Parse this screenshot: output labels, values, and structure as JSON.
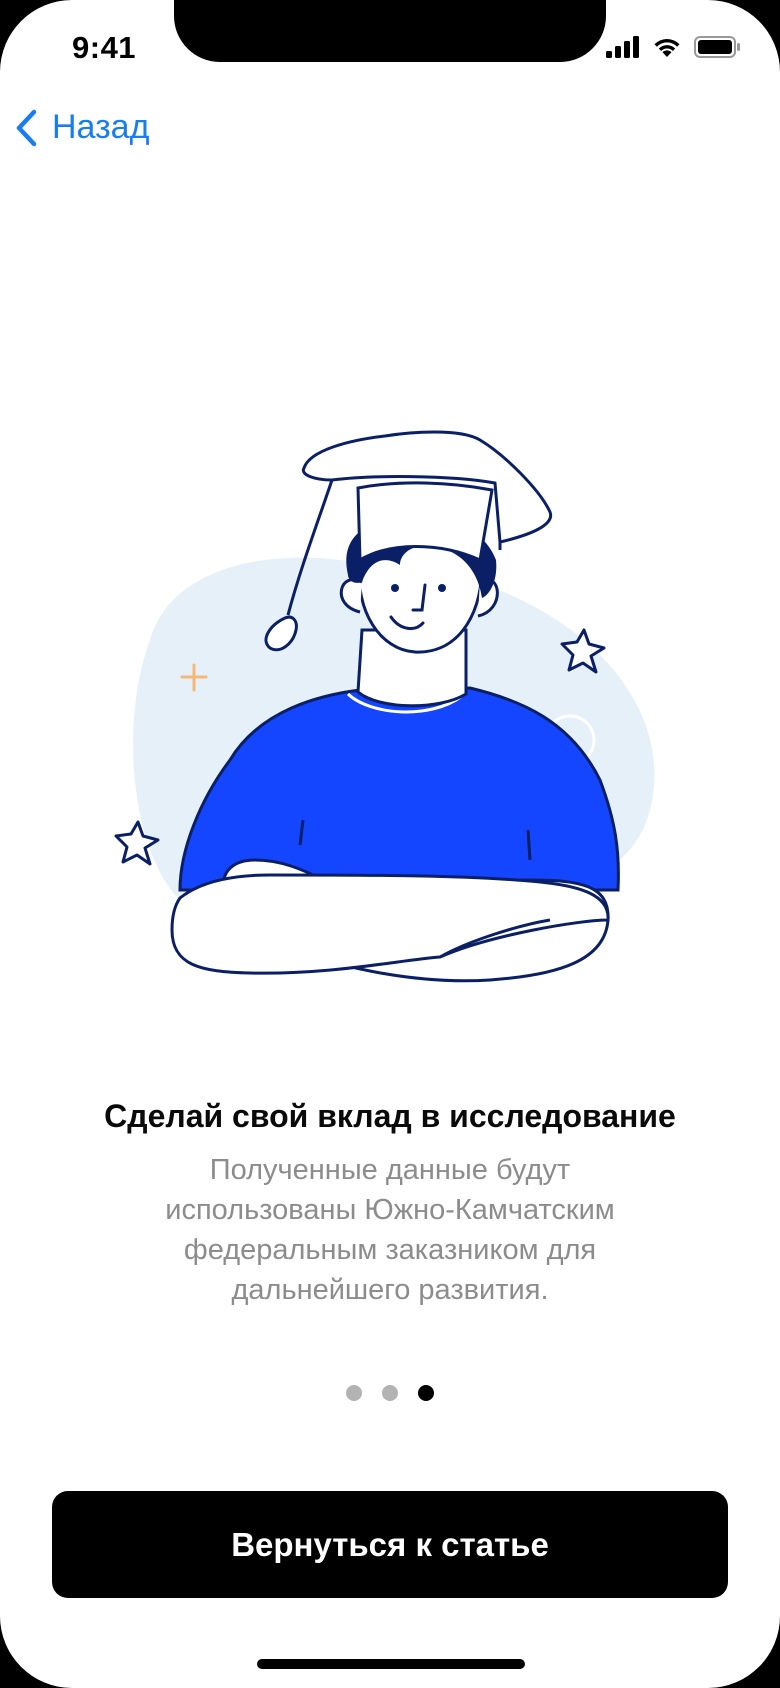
{
  "status_bar": {
    "time": "9:41",
    "icons": [
      "cellular-signal-icon",
      "wifi-icon",
      "battery-icon"
    ]
  },
  "nav": {
    "back_label": "Назад",
    "back_icon": "chevron-left-icon"
  },
  "content": {
    "title": "Сделай свой вклад в исследование",
    "subtitle": "Полученные данные будут использованы Южно-Камчатским федеральным заказником для дальнейшего развития."
  },
  "pager": {
    "total": 3,
    "active_index": 2
  },
  "cta": {
    "label": "Вернуться к статье"
  },
  "colors": {
    "accent": "#1a7cf3",
    "shirt": "#1446ff",
    "outline": "#0b1f66",
    "blob": "#e6f0f8",
    "cross": "#f5b87a",
    "subtitle": "#8c8c8c"
  }
}
